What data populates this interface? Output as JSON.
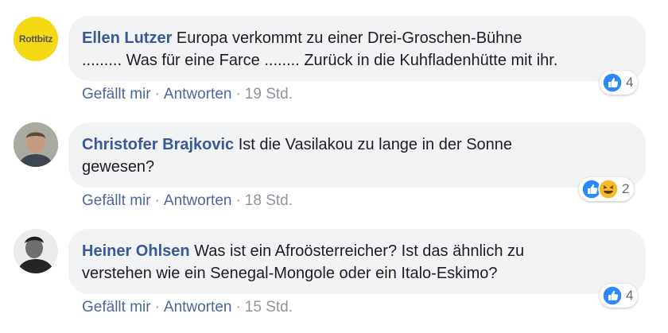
{
  "comments": [
    {
      "author": "Ellen Lutzer",
      "avatar_text": "Rottbitz",
      "text_line1": "Europa verkommt zu einer Drei-Groschen-Bühne",
      "text_line2": "......... Was für eine Farce ........ Zurück in die Kuhfladenhütte mit ihr.",
      "like_label": "Gefällt mir",
      "reply_label": "Antworten",
      "time": "19 Std.",
      "reaction_count": "4",
      "reaction_icons": [
        "like-icon"
      ],
      "colors": {
        "like": "#2d88ff",
        "avatar_bg": "#f5d915"
      }
    },
    {
      "author": "Christofer Brajkovic",
      "text_line1": "Ist die Vasilakou zu lange in der Sonne",
      "text_line2": "gewesen?",
      "like_label": "Gefällt mir",
      "reply_label": "Antworten",
      "time": "18 Std.",
      "reaction_count": "2",
      "reaction_icons": [
        "like-icon",
        "haha-icon"
      ],
      "colors": {
        "like": "#2d88ff",
        "haha": "#f7b928"
      }
    },
    {
      "author": "Heiner Ohlsen",
      "text_line1": "Was ist ein Afroösterreicher? Ist das ähnlich zu",
      "text_line2": "verstehen wie ein Senegal-Mongole oder ein Italo-Eskimo?",
      "like_label": "Gefällt mir",
      "reply_label": "Antworten",
      "time": "15 Std.",
      "reaction_count": "4",
      "reaction_icons": [
        "like-icon"
      ],
      "colors": {
        "like": "#2d88ff"
      }
    }
  ],
  "separator": "·"
}
